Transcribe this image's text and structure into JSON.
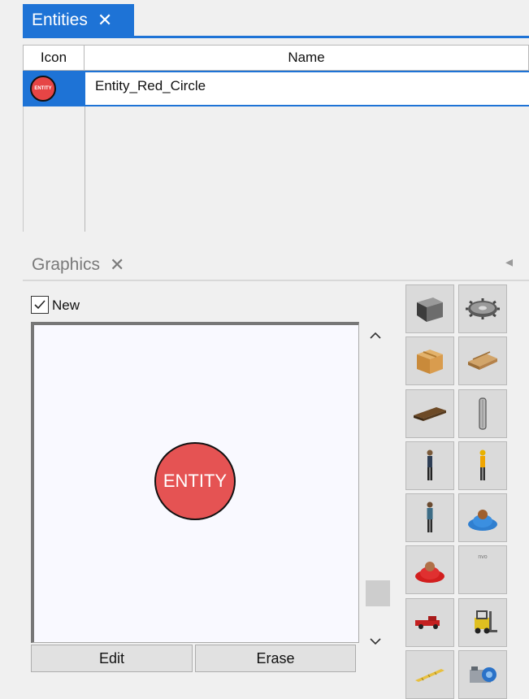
{
  "entities_panel": {
    "tab_title": "Entities",
    "close_glyph": "✕",
    "columns": [
      "Icon",
      "Name"
    ],
    "rows": [
      {
        "icon": "entity-red-circle-icon",
        "icon_text": "ENTITY",
        "name": "Entity_Red_Circle"
      }
    ],
    "accent_color": "#1e73d6"
  },
  "graphics_panel": {
    "tab_title": "Graphics",
    "close_glyph": "✕",
    "collapse_glyph": "◂",
    "new_checkbox": {
      "checked": true,
      "label": "New"
    },
    "preview_entity_text": "ENTITY",
    "preview_entity_color": "#e55353",
    "scroll_up_glyph": "⌃",
    "scroll_down_glyph": "⌄",
    "buttons": {
      "edit": "Edit",
      "erase": "Erase"
    },
    "library": [
      "cube-icon",
      "gear-icon",
      "cardboard-box-icon",
      "wooden-pallet-stack-icon",
      "pallet-icon",
      "cylinder-icon",
      "person-standing-icon",
      "worker-icon",
      "person-standing-2-icon",
      "seated-person-blue-icon",
      "seated-person-red-icon",
      "small-text-icon",
      "pickup-truck-icon",
      "forklift-icon",
      "conveyor-icon",
      "machine-icon"
    ],
    "library_small_text": "nvo"
  }
}
